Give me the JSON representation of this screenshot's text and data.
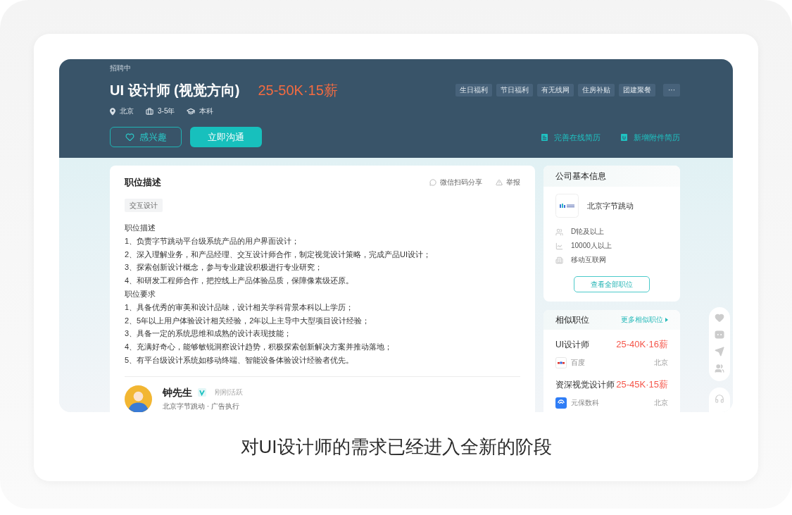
{
  "header": {
    "status": "招聘中",
    "title": "UI 设计师 (视觉方向)",
    "salary": "25-50K·15薪",
    "meta": [
      {
        "kind": "location",
        "text": "北京"
      },
      {
        "kind": "experience",
        "text": "3-5年"
      },
      {
        "kind": "education",
        "text": "本科"
      }
    ],
    "benefits": [
      "生日福利",
      "节日福利",
      "有无线网",
      "住房补贴",
      "团建聚餐"
    ],
    "more": "···",
    "buttons": [
      {
        "kind": "outline",
        "label": "感兴趣"
      },
      {
        "kind": "primary",
        "label": "立即沟通"
      }
    ],
    "links": [
      {
        "kind": "online",
        "label": "完善在线简历"
      },
      {
        "kind": "attachment",
        "label": "新增附件简历"
      }
    ]
  },
  "description": {
    "title": "职位描述",
    "actions": [
      {
        "kind": "share",
        "label": "微信扫码分享"
      },
      {
        "kind": "report",
        "label": "举报"
      }
    ],
    "tag": "交互设计",
    "sections": [
      {
        "heading": "职位描述",
        "items": [
          "1、负责字节跳动平台级系统产品的用户界面设计；",
          "2、深入理解业务，和产品经理、交互设计师合作，制定视觉设计策略，完成产品UI设计；",
          "3、探索创新设计概念，参与专业建设积极进行专业研究；",
          "4、和研发工程师合作，把控线上产品体验品质，保障像素级还原。"
        ]
      },
      {
        "heading": "职位要求",
        "items": [
          "1、具备优秀的审美和设计品味，设计相关学科背景本科以上学历；",
          "2、5年以上用户体验设计相关经验，2年以上主导中大型项目设计经验；",
          "3、具备一定的系统思维和成熟的设计表现技能；",
          "4、充满好奇心，能够敏锐洞察设计趋势，积极探索创新解决方案并推动落地；",
          "5、有平台级设计系统如移动终端、智能设备体验设计经验者优先。"
        ]
      }
    ]
  },
  "recruiter": {
    "name": "钟先生",
    "status": "刚刚活跃",
    "company": "北京字节跳动 · 广告执行"
  },
  "company": {
    "title": "公司基本信息",
    "name": "北京字节跳动",
    "facts": [
      {
        "kind": "funding",
        "text": "D轮及以上"
      },
      {
        "kind": "size",
        "text": "10000人以上"
      },
      {
        "kind": "industry",
        "text": "移动互联网"
      }
    ],
    "button": "查看全部职位"
  },
  "similar": {
    "title": "相似职位",
    "more": "更多相似职位",
    "jobs": [
      {
        "title": "UI设计师",
        "salary": "25-40K·16薪",
        "company": "百度",
        "city": "北京"
      },
      {
        "title": "资深视觉设计师",
        "salary": "25-45K·15薪",
        "company": "元保数科",
        "city": "北京"
      }
    ]
  },
  "caption": "对UI设计师的需求已经进入全新的阶段"
}
